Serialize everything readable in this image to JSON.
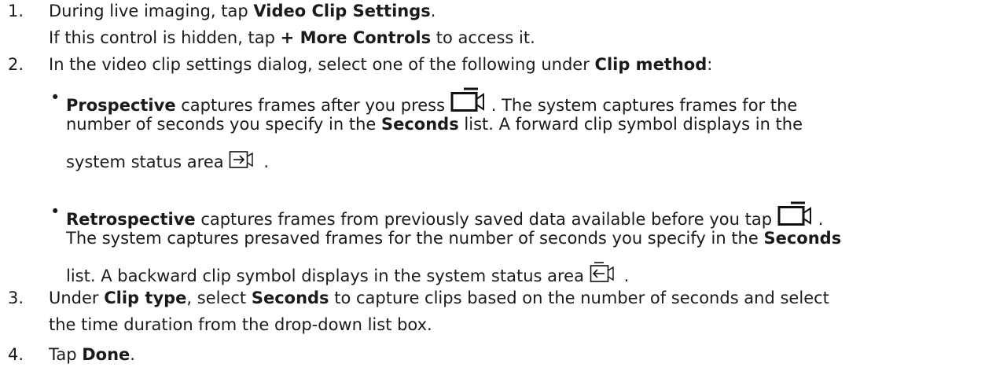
{
  "steps": [
    {
      "number": "1.",
      "line1": {
        "a": "During live imaging, tap ",
        "b": "Video Clip Settings",
        "c": "."
      },
      "line2": {
        "a": "If this control is hidden, tap ",
        "b": "+ More Controls",
        "c": " to access it."
      }
    },
    {
      "number": "2.",
      "line1": {
        "a": "In the video clip settings dialog, select one of the following under ",
        "b": "Clip method",
        "c": ":"
      },
      "bullets": [
        {
          "marker": "•",
          "term": "Prospective",
          "l1": " captures frames after you press ",
          "l1_after": ". The system captures frames for the",
          "l2a": "number of seconds you specify in the ",
          "l2b": "Seconds",
          "l2c": " list. A forward clip symbol displays in the",
          "l3": "system status area ",
          "l3_after": "."
        },
        {
          "marker": "•",
          "term": "Retrospective",
          "l1": " captures frames from previously saved data available before you tap ",
          "l1_after": ".",
          "l2a": "The system captures presaved frames for the number of seconds you specify in the ",
          "l2b": "Seconds",
          "l3": "list. A backward clip symbol displays in the system status area ",
          "l3_after": "."
        }
      ]
    },
    {
      "number": "3.",
      "line1": {
        "a": "Under ",
        "b": "Clip type",
        "c": ", select ",
        "d": "Seconds",
        "e": " to capture clips based on the number of seconds and select"
      },
      "line2": {
        "a": "the time duration from the drop-down list box."
      }
    },
    {
      "number": "4.",
      "line1": {
        "a": "Tap ",
        "b": "Done",
        "c": "."
      }
    }
  ],
  "icons": {
    "record": "video-record-icon",
    "forward": "forward-clip-icon",
    "backward": "backward-clip-icon"
  }
}
